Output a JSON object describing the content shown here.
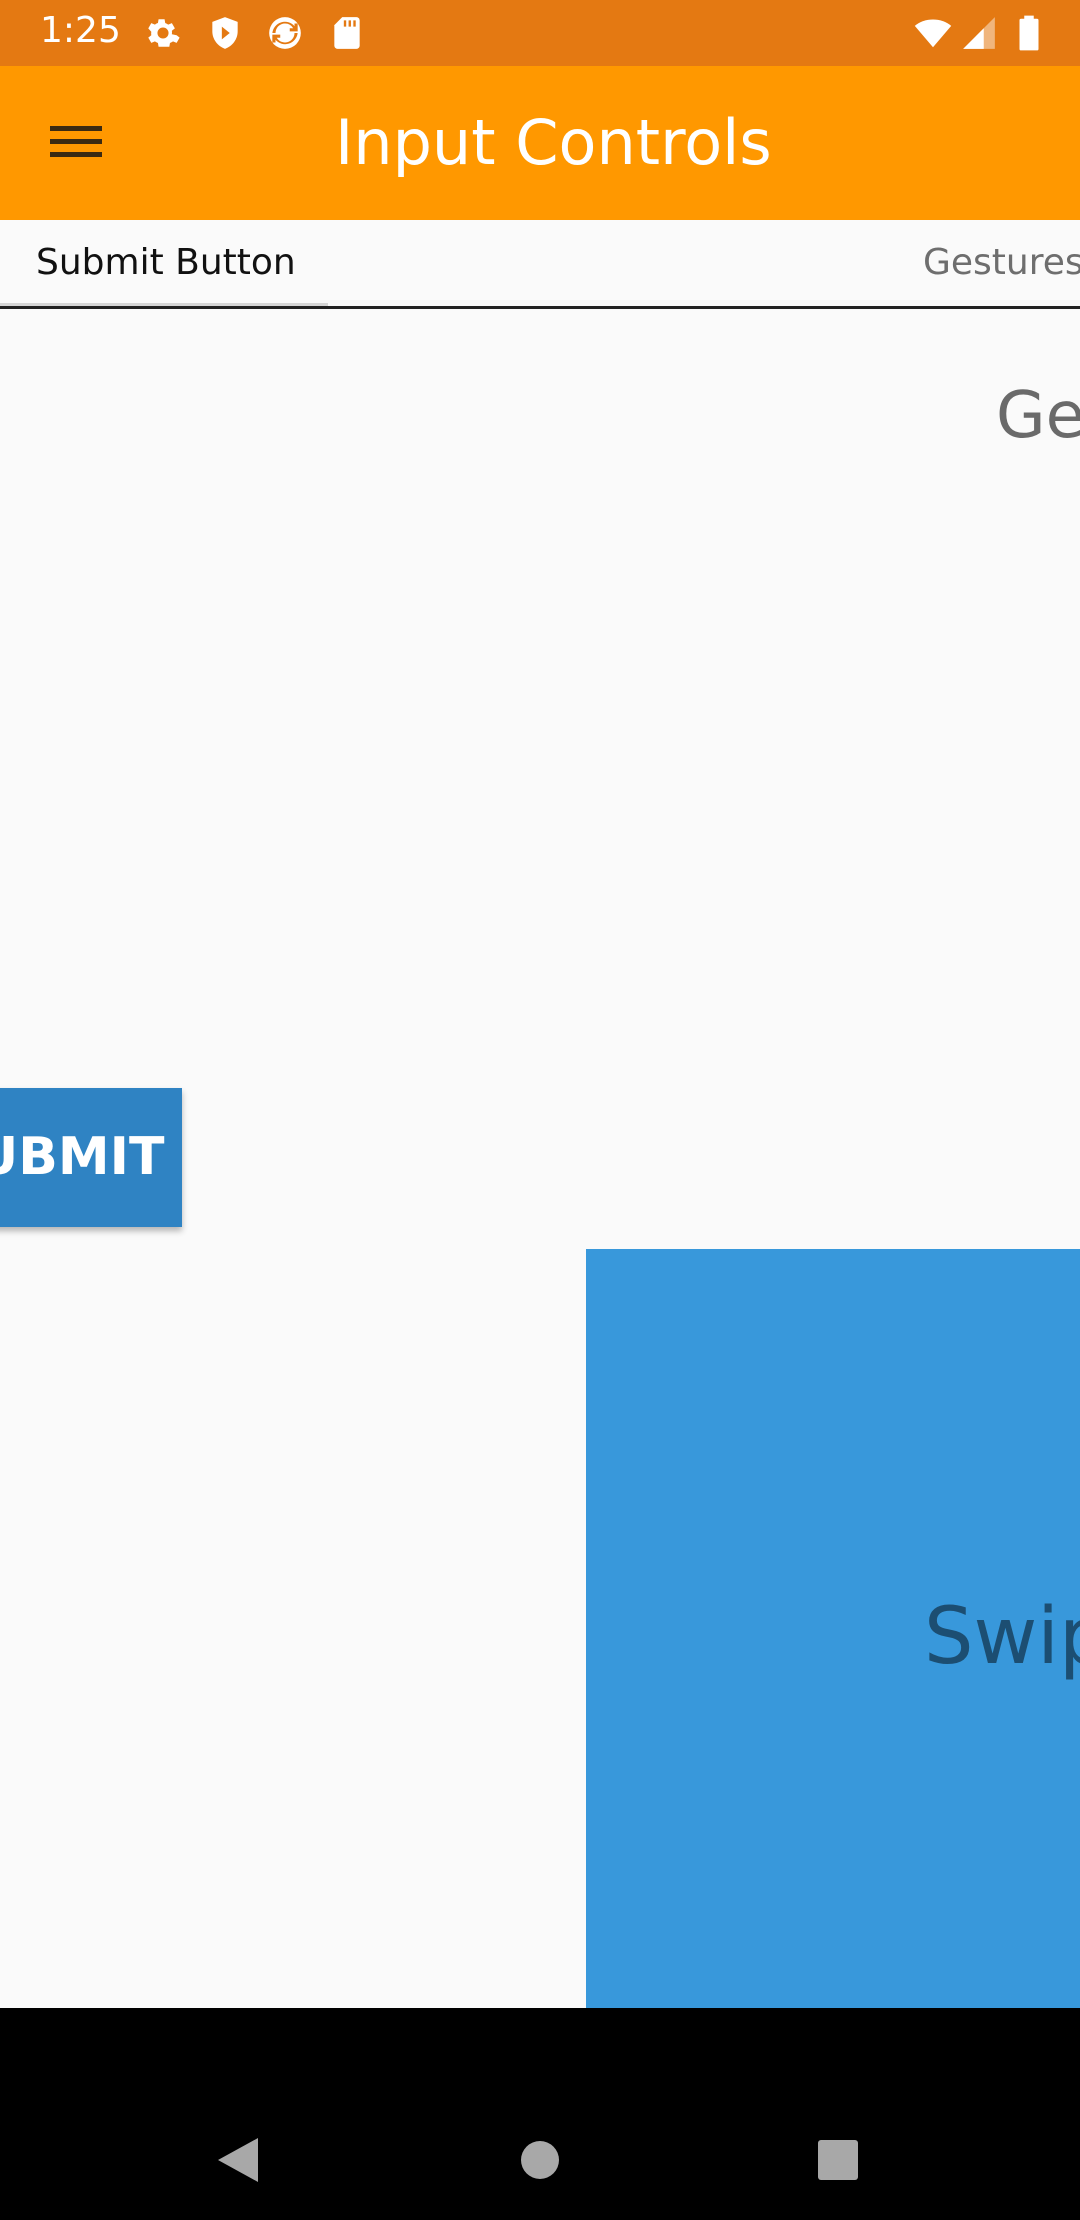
{
  "status_bar": {
    "time": "1:25",
    "left_icons": [
      "gear-icon",
      "shield-play-icon",
      "sync-icon",
      "sd-card-icon"
    ],
    "right_icons": [
      "wifi-icon",
      "signal-icon",
      "battery-icon"
    ],
    "color": "#e47912"
  },
  "app_bar": {
    "title": "Input Controls",
    "menu_icon": "hamburger-menu-icon",
    "color": "#ff9800"
  },
  "tabs": [
    {
      "label": "Submit Button",
      "selected": true
    },
    {
      "label": "Gestures",
      "selected": false
    }
  ],
  "content": {
    "gestures_heading": "Ges",
    "submit_button_label": "UBMIT",
    "swipe_label": "Swip",
    "swipe_color": "#3898db",
    "button_color": "#2f83c3"
  },
  "nav_bar": {
    "icons": [
      "back-icon",
      "home-icon",
      "recents-icon"
    ]
  }
}
